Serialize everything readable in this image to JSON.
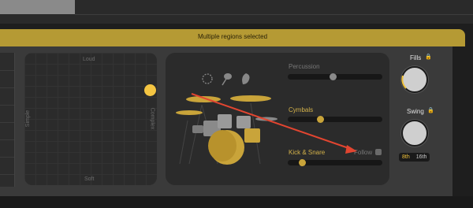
{
  "header": {
    "title": "Multiple regions selected"
  },
  "xy_pad": {
    "top_label": "Loud",
    "bottom_label": "Soft",
    "left_label": "Simple",
    "right_label": "Complex"
  },
  "kit": {
    "sliders": [
      {
        "label": "Percussion",
        "value": 0.45,
        "active": false
      },
      {
        "label": "Cymbals",
        "value": 0.35,
        "active": true
      },
      {
        "label": "Kick & Snare",
        "value": 0.15,
        "active": true
      }
    ],
    "follow_label": "Follow"
  },
  "right": {
    "fills_label": "Fills",
    "swing_label": "Swing",
    "swing_options": [
      "8th",
      "16th"
    ],
    "swing_selected": "8th"
  },
  "colors": {
    "accent": "#f4c542",
    "header": "#b59a34",
    "arrow": "#e24530"
  }
}
